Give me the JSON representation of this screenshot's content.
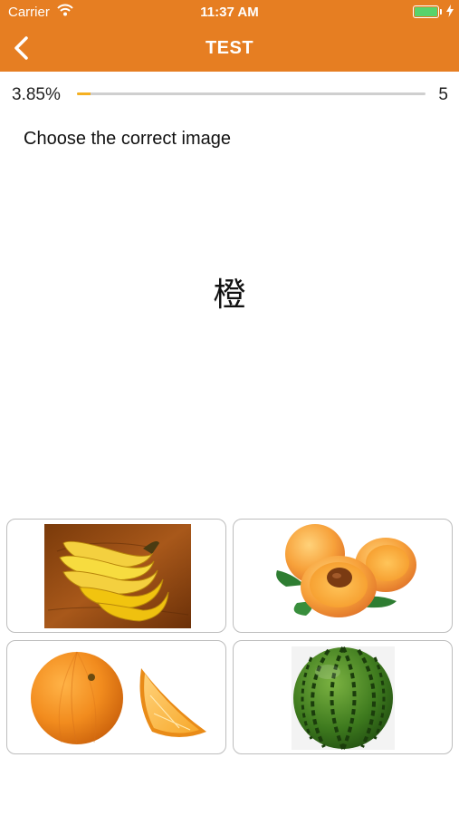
{
  "status_bar": {
    "carrier": "Carrier",
    "time": "11:37 AM"
  },
  "nav": {
    "title": "TEST"
  },
  "progress": {
    "percent_label": "3.85%",
    "fraction": 0.0385,
    "count": "5"
  },
  "prompt": "Choose the correct image",
  "question": "橙",
  "colors": {
    "header": "#E67E22",
    "progress": "#F5B021",
    "battery": "#59D36B"
  },
  "options": [
    {
      "image": "bananas"
    },
    {
      "image": "apricots"
    },
    {
      "image": "orange"
    },
    {
      "image": "watermelon"
    }
  ]
}
